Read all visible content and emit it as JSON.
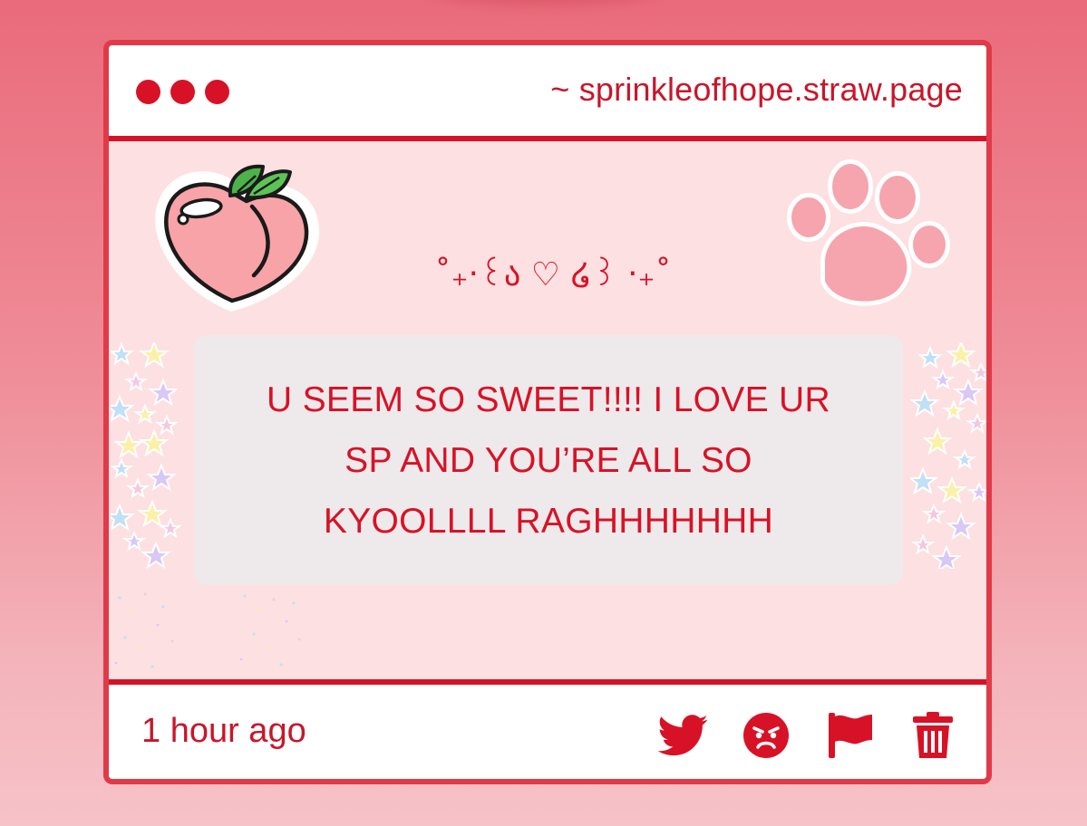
{
  "window": {
    "url": "~ sprinkleofhope.straw.page"
  },
  "post": {
    "kaomoji": "˚₊‧꒰ა ♡ ໒꒱ ‧₊˚",
    "message": "U SEEM SO SWEET!!!! I LOVE UR SP AND YOU’RE ALL SO KYOOLLLL RAGHHHHHHH",
    "timestamp": "1 hour ago"
  },
  "actions": [
    {
      "name": "twitter-share-button",
      "icon": "twitter-bird-icon"
    },
    {
      "name": "angry-react-button",
      "icon": "angry-face-icon"
    },
    {
      "name": "report-button",
      "icon": "flag-icon"
    },
    {
      "name": "delete-button",
      "icon": "trash-icon"
    }
  ],
  "colors": {
    "accent": "#d81226",
    "border": "#e03a49",
    "content_bg": "#fde0e2",
    "message_bg": "#eeeaec"
  }
}
